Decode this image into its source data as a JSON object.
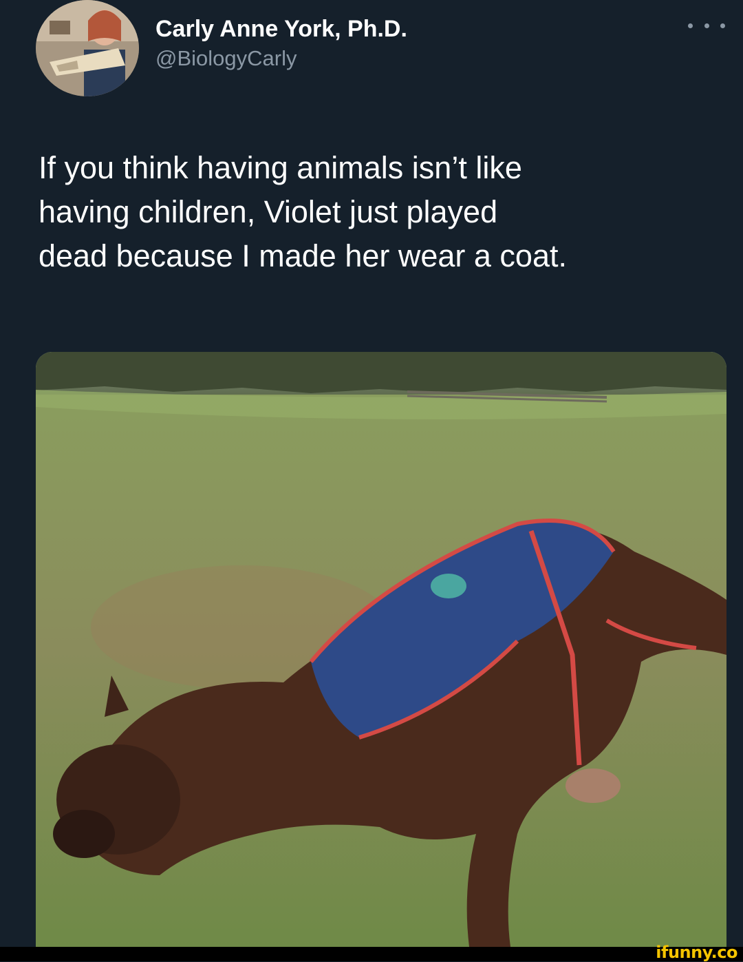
{
  "tweet": {
    "display_name": "Carly Anne York, Ph.D.",
    "handle": "@BiologyCarly",
    "text": "If you think having animals isn’t like\nhaving children, Violet just played\ndead because I made her wear a coat.",
    "more_icon": "more-horizontal-icon"
  },
  "watermark": "ifunny.co",
  "colors": {
    "background": "#15202b",
    "secondary_text": "#8b98a5",
    "watermark": "#f5c400"
  }
}
